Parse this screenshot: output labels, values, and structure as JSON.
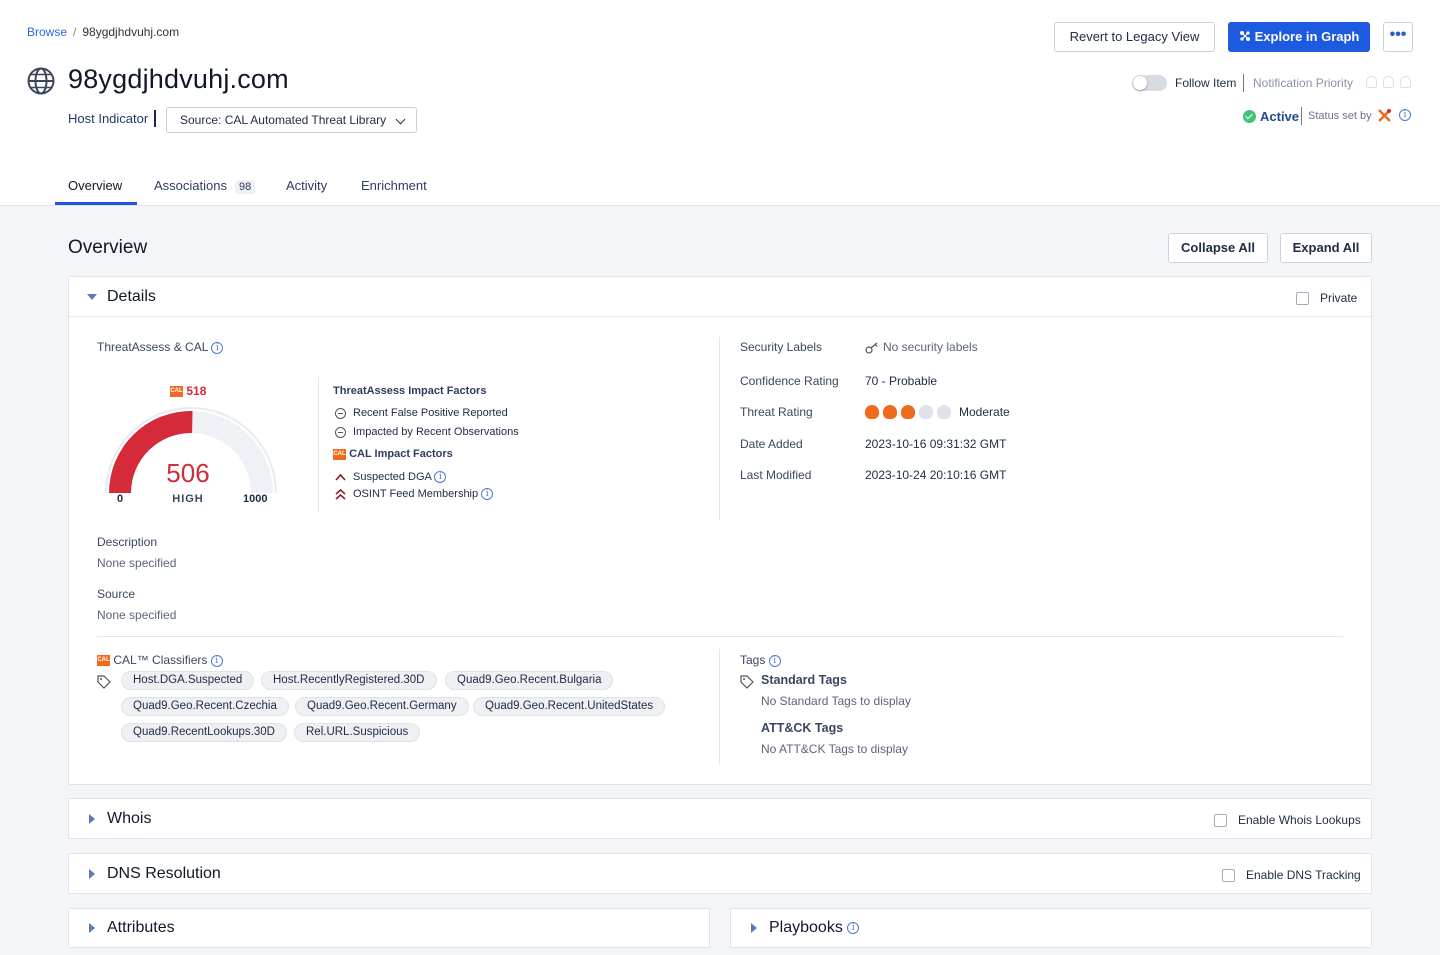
{
  "breadcrumb": {
    "root": "Browse",
    "current": "98ygdjhdvuhj.com"
  },
  "header": {
    "title": "98ygdjhdvuhj.com",
    "type_label": "Host Indicator",
    "source_label": "Source: CAL Automated Threat Library",
    "legacy_button": "Revert to Legacy View",
    "graph_button": "Explore in Graph",
    "more_button": "•••",
    "follow_label": "Follow Item",
    "notification_label": "Notification Priority",
    "status_label": "Active",
    "status_set_by": "Status set by"
  },
  "tabs": [
    {
      "label": "Overview",
      "count": ""
    },
    {
      "label": "Associations",
      "count": "98"
    },
    {
      "label": "Activity",
      "count": ""
    },
    {
      "label": "Enrichment",
      "count": ""
    }
  ],
  "overview": {
    "title": "Overview",
    "collapse_all": "Collapse All",
    "expand_all": "Expand All"
  },
  "details": {
    "title": "Details",
    "private_label": "Private",
    "threatassess_label": "ThreatAssess & CAL",
    "cal_score": "518",
    "gauge": {
      "value": "506",
      "level": "HIGH",
      "min": "0",
      "max": "1000",
      "fill_fraction": 0.506
    },
    "impact_title": "ThreatAssess Impact Factors",
    "impact_factors": [
      "Recent False Positive Reported",
      "Impacted by Recent Observations"
    ],
    "cal_impact_title": "CAL Impact Factors",
    "cal_badge": "CAL",
    "cal_factors": [
      "Suspected DGA",
      "OSINT Feed Membership"
    ],
    "fields": {
      "security_labels": {
        "label": "Security Labels",
        "value": "No security labels"
      },
      "confidence": {
        "label": "Confidence Rating",
        "value": "70 - Probable"
      },
      "threat": {
        "label": "Threat Rating",
        "value": "Moderate",
        "rating": 3,
        "max": 5
      },
      "date_added": {
        "label": "Date Added",
        "value": "2023-10-16 09:31:32 GMT"
      },
      "last_modified": {
        "label": "Last Modified",
        "value": "2023-10-24 20:10:16 GMT"
      }
    },
    "description": {
      "label": "Description",
      "value": "None specified"
    },
    "source": {
      "label": "Source",
      "value": "None specified"
    },
    "classifiers_label": "CAL™ Classifiers",
    "classifiers": [
      "Host.DGA.Suspected",
      "Host.RecentlyRegistered.30D",
      "Quad9.Geo.Recent.Bulgaria",
      "Quad9.Geo.Recent.Czechia",
      "Quad9.Geo.Recent.Germany",
      "Quad9.Geo.Recent.UnitedStates",
      "Quad9.RecentLookups.30D",
      "Rel.URL.Suspicious"
    ],
    "tags_label": "Tags",
    "standard_tags_title": "Standard Tags",
    "standard_tags_empty": "No Standard Tags to display",
    "attack_tags_title": "ATT&CK Tags",
    "attack_tags_empty": "No ATT&CK Tags to display"
  },
  "whois": {
    "title": "Whois",
    "toggle_label": "Enable Whois Lookups"
  },
  "dns": {
    "title": "DNS Resolution",
    "toggle_label": "Enable DNS Tracking"
  },
  "attributes": {
    "title": "Attributes"
  },
  "playbooks": {
    "title": "Playbooks"
  },
  "colors": {
    "primary": "#1d5ae0",
    "gauge_fill": "#d42a3a",
    "cal_orange": "#f06a1d",
    "active_green": "#41c47a"
  }
}
